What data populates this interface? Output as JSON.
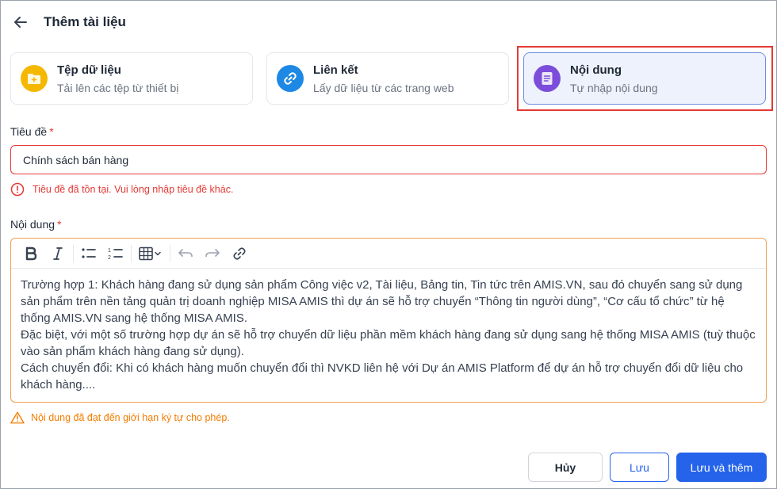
{
  "header": {
    "title": "Thêm tài liệu",
    "back_icon": "arrow-left-icon"
  },
  "source_types": [
    {
      "title": "Tệp dữ liệu",
      "subtitle": "Tải lên các tệp từ thiết bị",
      "icon": "folder-add-icon",
      "color": "#f5b800"
    },
    {
      "title": "Liên kết",
      "subtitle": "Lấy dữ liệu từ các trang web",
      "icon": "link-icon",
      "color": "#1e88e5"
    },
    {
      "title": "Nội dung",
      "subtitle": "Tự nhập nội dung",
      "icon": "document-icon",
      "color": "#7c4ddb",
      "selected": true
    }
  ],
  "form": {
    "title_label": "Tiêu đề",
    "title_required": "*",
    "title_value": "Chính sách bán hàng",
    "title_error": "Tiêu đề đã tồn tại. Vui lòng nhập tiêu đề khác.",
    "content_label": "Nội dung",
    "content_required": "*",
    "content_paragraphs": [
      "Trường hợp 1: Khách hàng đang sử dụng sản phẩm Công việc v2, Tài liệu, Bảng tin, Tin tức trên AMIS.VN, sau đó chuyển sang sử dụng sản phẩm trên nền tảng quản trị doanh nghiệp MISA AMIS thì dự án sẽ hỗ trợ chuyển “Thông tin người dùng”, “Cơ cấu tổ chức” từ hệ thống AMIS.VN sang hệ thống MISA AMIS.",
      "Đặc biệt, với một số trường hợp dự án sẽ hỗ trợ chuyển dữ liệu phần mềm khách hàng đang sử dụng sang hệ thống MISA AMIS (tuỳ thuộc vào sản phẩm khách hàng đang sử dụng).",
      "Cách chuyển đổi: Khi có khách hàng muốn chuyển đổi thì NVKD liên hệ với Dự án AMIS Platform để dự án hỗ trợ chuyển đổi dữ liệu cho khách hàng...."
    ],
    "content_warning": "Nội dung đã đạt đến giới hạn ký tự cho phép."
  },
  "toolbar": [
    "bold-icon",
    "italic-icon",
    "bullet-list-icon",
    "numbered-list-icon",
    "table-icon",
    "undo-icon",
    "redo-icon",
    "link-icon"
  ],
  "actions": {
    "cancel": "Hủy",
    "save": "Lưu",
    "save_and_add": "Lưu và thêm"
  },
  "colors": {
    "primary": "#2563eb",
    "error": "#e53935",
    "warning": "#f57c00"
  }
}
